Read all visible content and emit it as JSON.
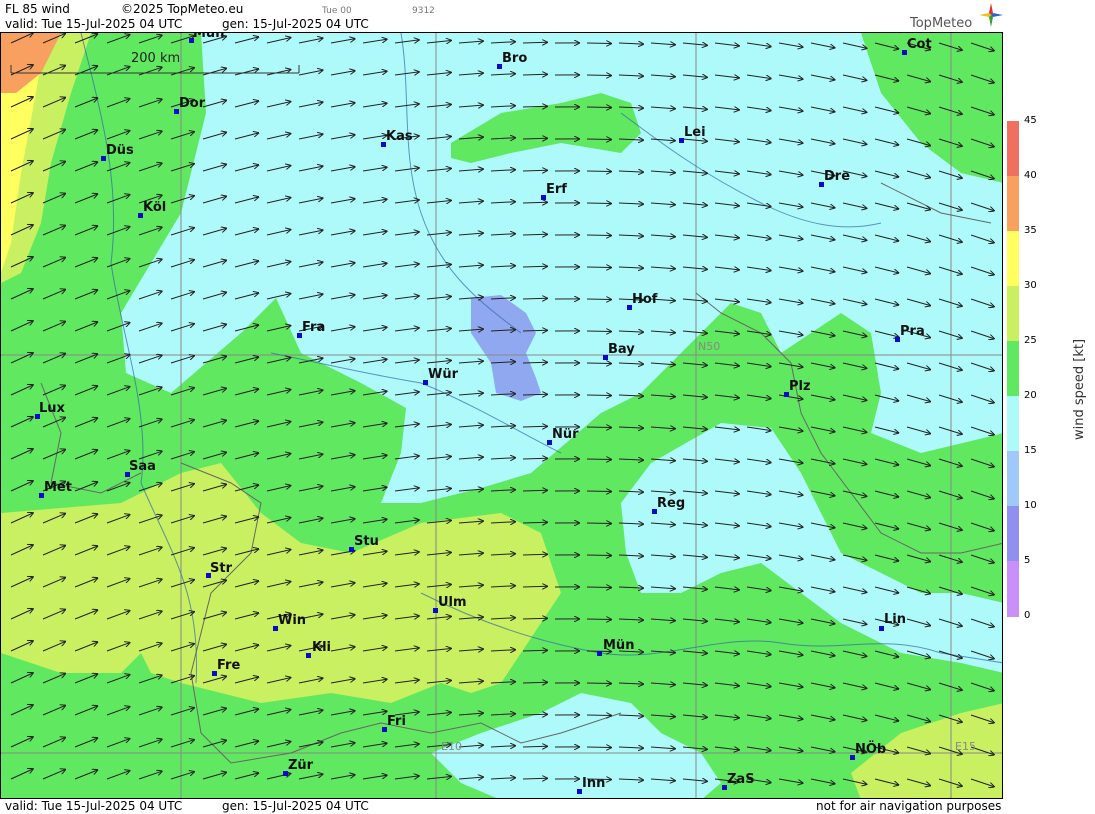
{
  "header": {
    "product": "FL 85 wind",
    "copyright": "©2025 TopMeteo.eu",
    "step": "Tue 00",
    "code": "9312",
    "valid": "valid:  Tue  15-Jul-2025  04 UTC",
    "gen": "gen: 15-Jul-2025 04 UTC",
    "brand": "TopMeteo"
  },
  "footer": {
    "valid": "valid:  Tue  15-Jul-2025  04 UTC",
    "gen": "gen: 15-Jul-2025 04 UTC",
    "disclaimer": "not for air navigation purposes"
  },
  "map": {
    "scale_label": "200 km",
    "grid_labels": [
      "N50",
      "E10",
      "E15"
    ],
    "cities": [
      {
        "name": "Mün",
        "id": "muenster"
      },
      {
        "name": "Bro",
        "id": "brocken"
      },
      {
        "name": "Cot",
        "id": "cottbus"
      },
      {
        "name": "Dor",
        "id": "dortmund"
      },
      {
        "name": "Kas",
        "id": "kassel"
      },
      {
        "name": "Lei",
        "id": "leipzig"
      },
      {
        "name": "Düs",
        "id": "duesseldorf"
      },
      {
        "name": "Erf",
        "id": "erfurt"
      },
      {
        "name": "Dre",
        "id": "dresden"
      },
      {
        "name": "Köl",
        "id": "koeln"
      },
      {
        "name": "Hof",
        "id": "hof"
      },
      {
        "name": "Fra",
        "id": "frankfurt"
      },
      {
        "name": "Pra",
        "id": "praha"
      },
      {
        "name": "Bay",
        "id": "bayreuth"
      },
      {
        "name": "Wür",
        "id": "wuerzburg"
      },
      {
        "name": "Plz",
        "id": "plzen"
      },
      {
        "name": "Lux",
        "id": "luxembourg"
      },
      {
        "name": "Nür",
        "id": "nuernberg"
      },
      {
        "name": "Saa",
        "id": "saarbruecken"
      },
      {
        "name": "Met",
        "id": "metz"
      },
      {
        "name": "Reg",
        "id": "regensburg"
      },
      {
        "name": "Stu",
        "id": "stuttgart"
      },
      {
        "name": "Str",
        "id": "strasbourg"
      },
      {
        "name": "Ulm",
        "id": "ulm"
      },
      {
        "name": "Win",
        "id": "winterberg"
      },
      {
        "name": "Lin",
        "id": "linz"
      },
      {
        "name": "Kli",
        "id": "klippeneck"
      },
      {
        "name": "Mün",
        "id": "muenchen"
      },
      {
        "name": "Fre",
        "id": "freiburg"
      },
      {
        "name": "Fri",
        "id": "friedrichshafen"
      },
      {
        "name": "NÖb",
        "id": "noeb"
      },
      {
        "name": "Zür",
        "id": "zuerich"
      },
      {
        "name": "Inn",
        "id": "innsbruck"
      },
      {
        "name": "ZaS",
        "id": "zell-am-see"
      }
    ]
  },
  "legend": {
    "title": "wind  speed  [kt]",
    "ticks": [
      "45",
      "40",
      "35",
      "30",
      "25",
      "20",
      "15",
      "10",
      "5",
      "0"
    ],
    "colors": [
      "#f07060",
      "#f8a060",
      "#ffff60",
      "#c8f060",
      "#60e860",
      "#aefafa",
      "#a0c8f8",
      "#9090f0",
      "#c890f8"
    ]
  }
}
